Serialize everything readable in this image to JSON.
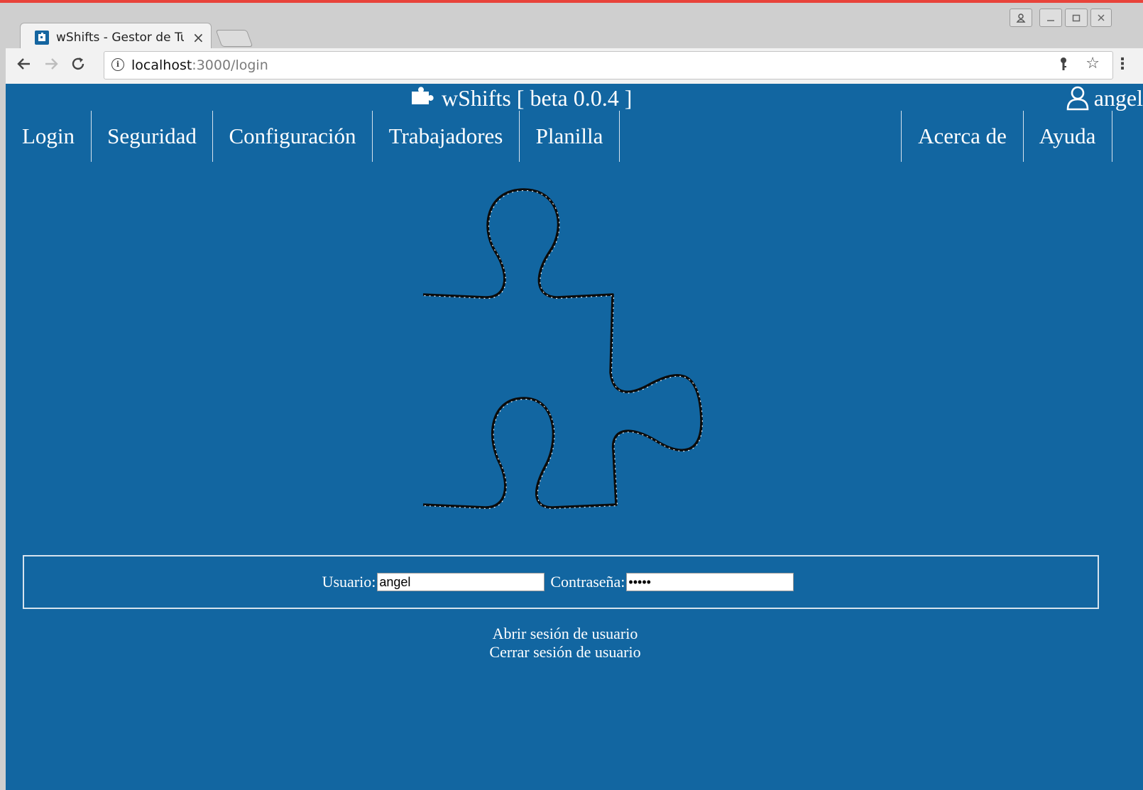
{
  "browser": {
    "tab_title": "wShifts - Gestor de Tu",
    "tab_close": "×",
    "url_host": "localhost",
    "url_rest": ":3000/login",
    "colors": {
      "accent": "#e8433a",
      "page_bg": "#1266a1"
    }
  },
  "header": {
    "app_title": "wShifts [ beta 0.0.4 ]",
    "user_name": "angel"
  },
  "nav": {
    "left": [
      "Login",
      "Seguridad",
      "Configuración",
      "Trabajadores",
      "Planilla"
    ],
    "right": [
      "Acerca de",
      "Ayuda"
    ]
  },
  "login": {
    "user_label": "Usuario:",
    "user_value": "angel",
    "password_label": "Contraseña:",
    "password_value": "•••••",
    "open_session": "Abrir sesión de usuario",
    "close_session": "Cerrar sesión de usuario"
  }
}
